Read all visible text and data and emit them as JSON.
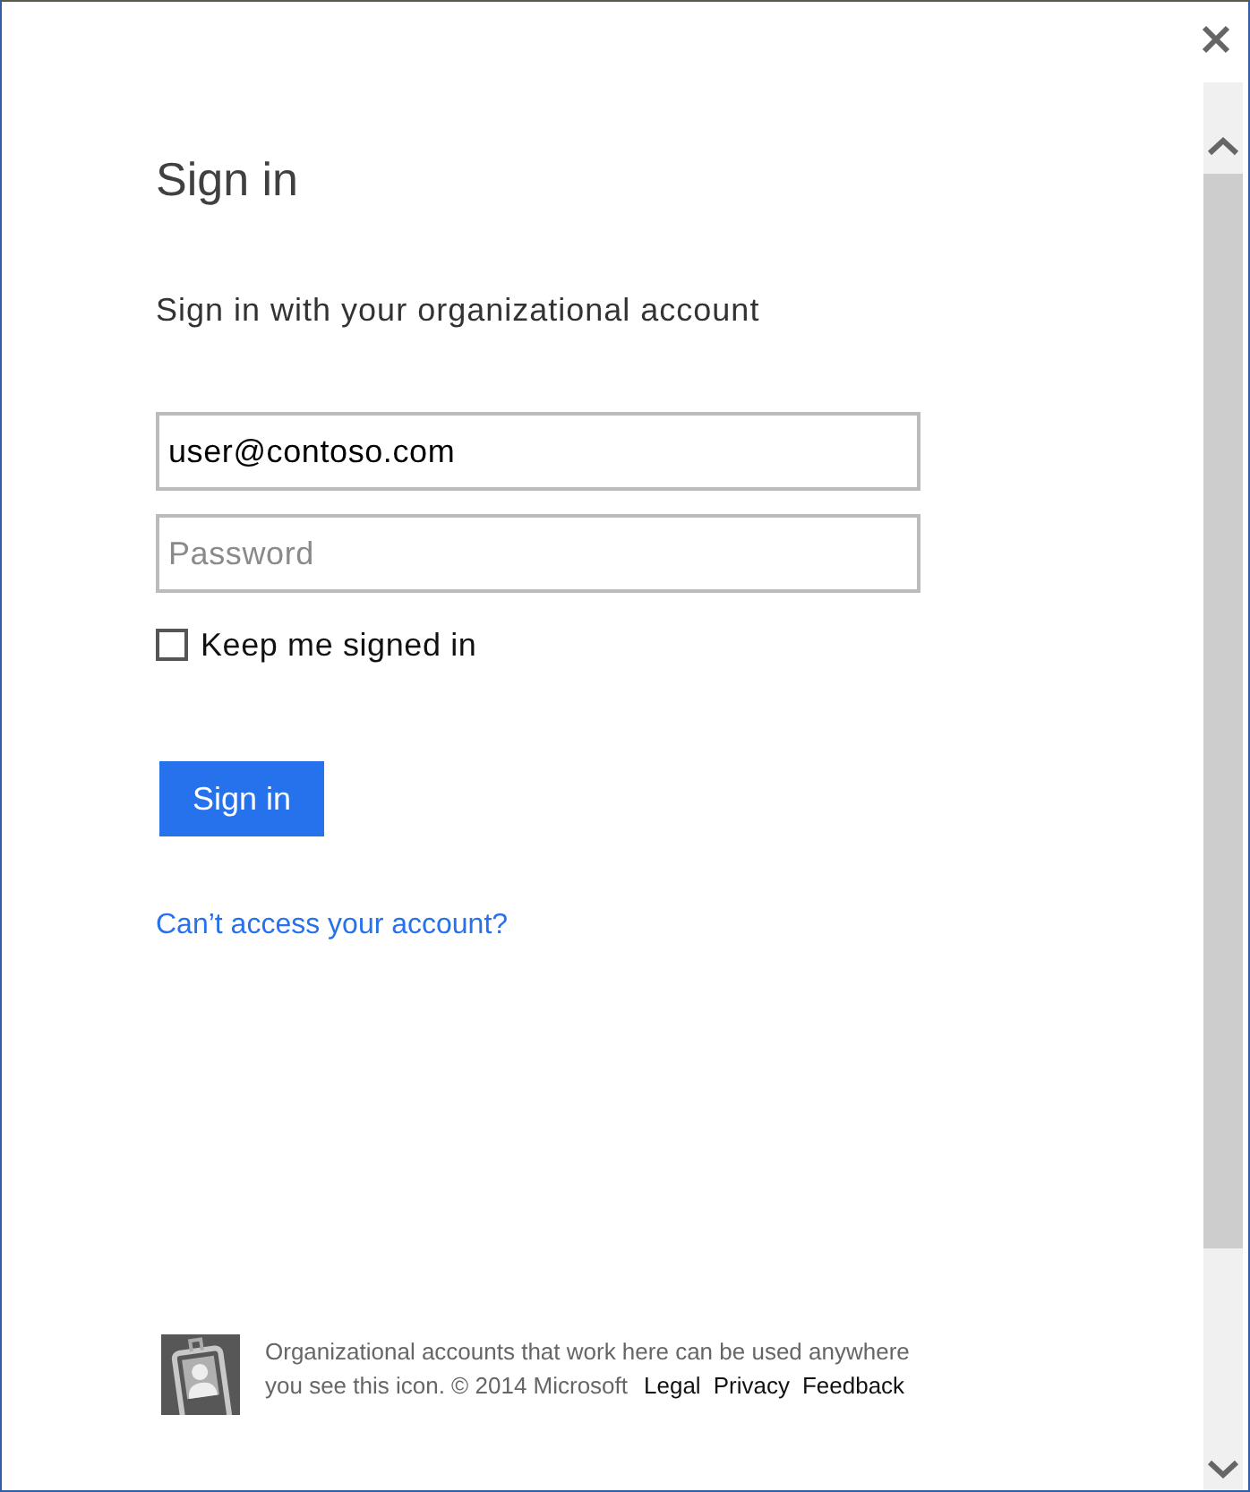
{
  "title": "Sign in",
  "subtitle": "Sign in with your organizational account",
  "fields": [
    {
      "kind": "email",
      "value": "user@contoso.com"
    },
    {
      "kind": "password",
      "placeholder": "Password"
    }
  ],
  "keep_signed_in": {
    "label": "Keep me signed in",
    "checked": false
  },
  "submit": {
    "label": "Sign in"
  },
  "help_link": "Can’t access your account?",
  "footer": {
    "text": "Organizational accounts that work here can be used anywhere you see this icon. © 2014 Microsoft",
    "links": [
      "Legal",
      "Privacy",
      "Feedback"
    ]
  }
}
